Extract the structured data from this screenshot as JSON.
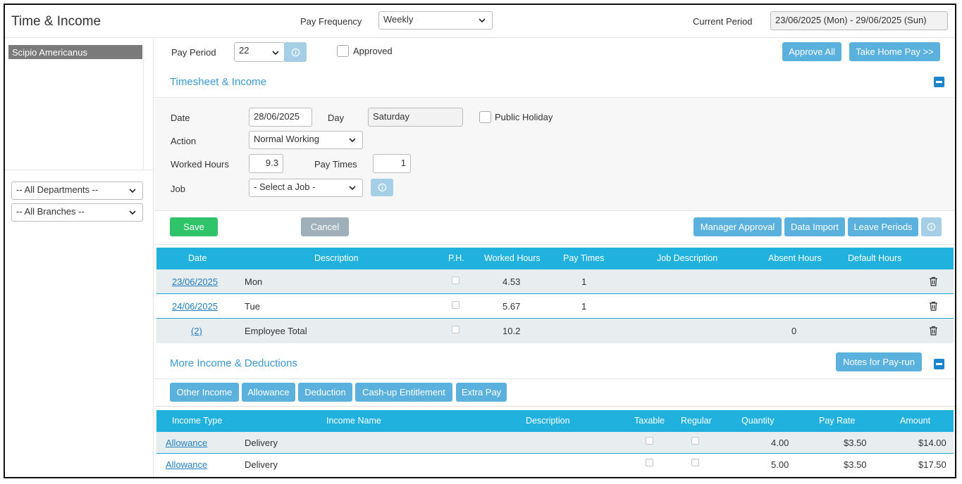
{
  "header": {
    "title": "Time & Income",
    "pay_frequency_label": "Pay Frequency",
    "pay_frequency_value": "Weekly",
    "current_period_label": "Current Period",
    "current_period_value": "23/06/2025 (Mon) - 29/06/2025 (Sun)"
  },
  "sidebar": {
    "employees": [
      "Scipio Americanus"
    ],
    "departments_filter": "-- All Departments --",
    "branches_filter": "-- All Branches --"
  },
  "pay_period_bar": {
    "pay_period_label": "Pay Period",
    "pay_period_value": "22",
    "approved_label": "Approved",
    "approve_all_button": "Approve All",
    "take_home_pay_button": "Take Home Pay >>"
  },
  "timesheet": {
    "section_title": "Timesheet & Income",
    "date_label": "Date",
    "date_value": "28/06/2025",
    "day_label": "Day",
    "day_value": "Saturday",
    "public_holiday_label": "Public Holiday",
    "action_label": "Action",
    "action_value": "Normal Working",
    "worked_hours_label": "Worked Hours",
    "worked_hours_value": "9.3",
    "pay_times_label": "Pay Times",
    "pay_times_value": "1",
    "job_label": "Job",
    "job_value": "- Select a Job -",
    "save_button": "Save",
    "cancel_button": "Cancel",
    "manager_approval_button": "Manager Approval",
    "data_import_button": "Data Import",
    "leave_periods_button": "Leave Periods",
    "columns": [
      "Date",
      "Description",
      "P.H.",
      "Worked Hours",
      "Pay Times",
      "Job Description",
      "Absent Hours",
      "Default Hours"
    ],
    "rows": [
      {
        "date": "23/06/2025",
        "description": "Mon",
        "worked_hours": "4.53",
        "pay_times": "1",
        "absent_hours": ""
      },
      {
        "date": "24/06/2025",
        "description": "Tue",
        "worked_hours": "5.67",
        "pay_times": "1",
        "absent_hours": ""
      },
      {
        "date": "(2)",
        "description": "Employee Total",
        "worked_hours": "10.2",
        "pay_times": "",
        "absent_hours": "0"
      }
    ]
  },
  "income": {
    "section_title": "More Income & Deductions",
    "notes_button": "Notes for Pay-run",
    "tabs": [
      "Other Income",
      "Allowance",
      "Deduction",
      "Cash-up Entitlement",
      "Extra Pay"
    ],
    "columns": [
      "Income Type",
      "Income Name",
      "Description",
      "Taxable",
      "Regular",
      "Quantity",
      "Pay Rate",
      "Amount"
    ],
    "rows": [
      {
        "type": "Allowance",
        "name": "Delivery",
        "quantity": "4.00",
        "rate": "$3.50",
        "amount": "$14.00"
      },
      {
        "type": "Allowance",
        "name": "Delivery",
        "quantity": "5.00",
        "rate": "$3.50",
        "amount": "$17.50"
      }
    ]
  },
  "colors": {
    "accent": "#20b1de",
    "button_blue": "#5bb1dd",
    "save_green": "#2fc36a",
    "link": "#1f7fc2"
  }
}
